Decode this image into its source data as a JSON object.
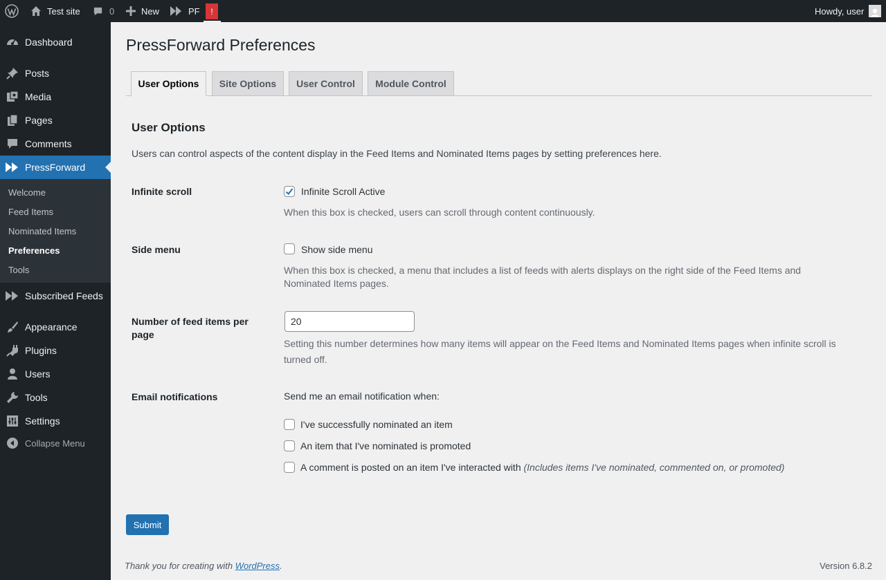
{
  "adminbar": {
    "site_name": "Test site",
    "comments_count": "0",
    "new_label": "New",
    "pf_label": "PF",
    "pf_alert": "!",
    "howdy": "Howdy, user"
  },
  "sidebar": {
    "items": [
      {
        "label": "Dashboard",
        "icon": "dashboard-icon"
      },
      {
        "label": "Posts",
        "icon": "pin-icon"
      },
      {
        "label": "Media",
        "icon": "media-icon"
      },
      {
        "label": "Pages",
        "icon": "pages-icon"
      },
      {
        "label": "Comments",
        "icon": "comment-icon"
      },
      {
        "label": "PressForward",
        "icon": "pressforward-icon"
      },
      {
        "label": "Subscribed Feeds",
        "icon": "pressforward-icon"
      },
      {
        "label": "Appearance",
        "icon": "paintbrush-icon"
      },
      {
        "label": "Plugins",
        "icon": "plugin-icon"
      },
      {
        "label": "Users",
        "icon": "user-icon"
      },
      {
        "label": "Tools",
        "icon": "wrench-icon"
      },
      {
        "label": "Settings",
        "icon": "settings-icon"
      }
    ],
    "submenu": [
      "Welcome",
      "Feed Items",
      "Nominated Items",
      "Preferences",
      "Tools"
    ],
    "collapse": "Collapse Menu"
  },
  "page": {
    "title": "PressForward Preferences",
    "tabs": [
      "User Options",
      "Site Options",
      "User Control",
      "Module Control"
    ],
    "section_title": "User Options",
    "description": "Users can control aspects of the content display in the Feed Items and Nominated Items pages by setting preferences here.",
    "infinite_scroll": {
      "label": "Infinite scroll",
      "checkbox_label": "Infinite Scroll Active",
      "checked": true,
      "help": "When this box is checked, users can scroll through content continuously."
    },
    "side_menu": {
      "label": "Side menu",
      "checkbox_label": "Show side menu",
      "checked": false,
      "help": "When this box is checked, a menu that includes a list of feeds with alerts displays on the right side of the Feed Items and Nominated Items pages."
    },
    "items_per_page": {
      "label": "Number of feed items per page",
      "value": "20",
      "help": "Setting this number determines how many items will appear on the Feed Items and Nominated Items pages when infinite scroll is turned off."
    },
    "email": {
      "label": "Email notifications",
      "intro": "Send me an email notification when:",
      "options": [
        "I've successfully nominated an item",
        "An item that I've nominated is promoted",
        "A comment is posted on an item I've interacted with"
      ],
      "note": "(Includes items I've nominated, commented on, or promoted)"
    },
    "submit": "Submit"
  },
  "footer": {
    "thanks_prefix": "Thank you for creating with",
    "wp_link": "WordPress",
    "thanks_suffix": ".",
    "version": "Version 6.8.2"
  },
  "colors": {
    "accent": "#2271b1",
    "admin_dark": "#1d2327",
    "background": "#f0f0f1",
    "alert": "#d63638"
  }
}
